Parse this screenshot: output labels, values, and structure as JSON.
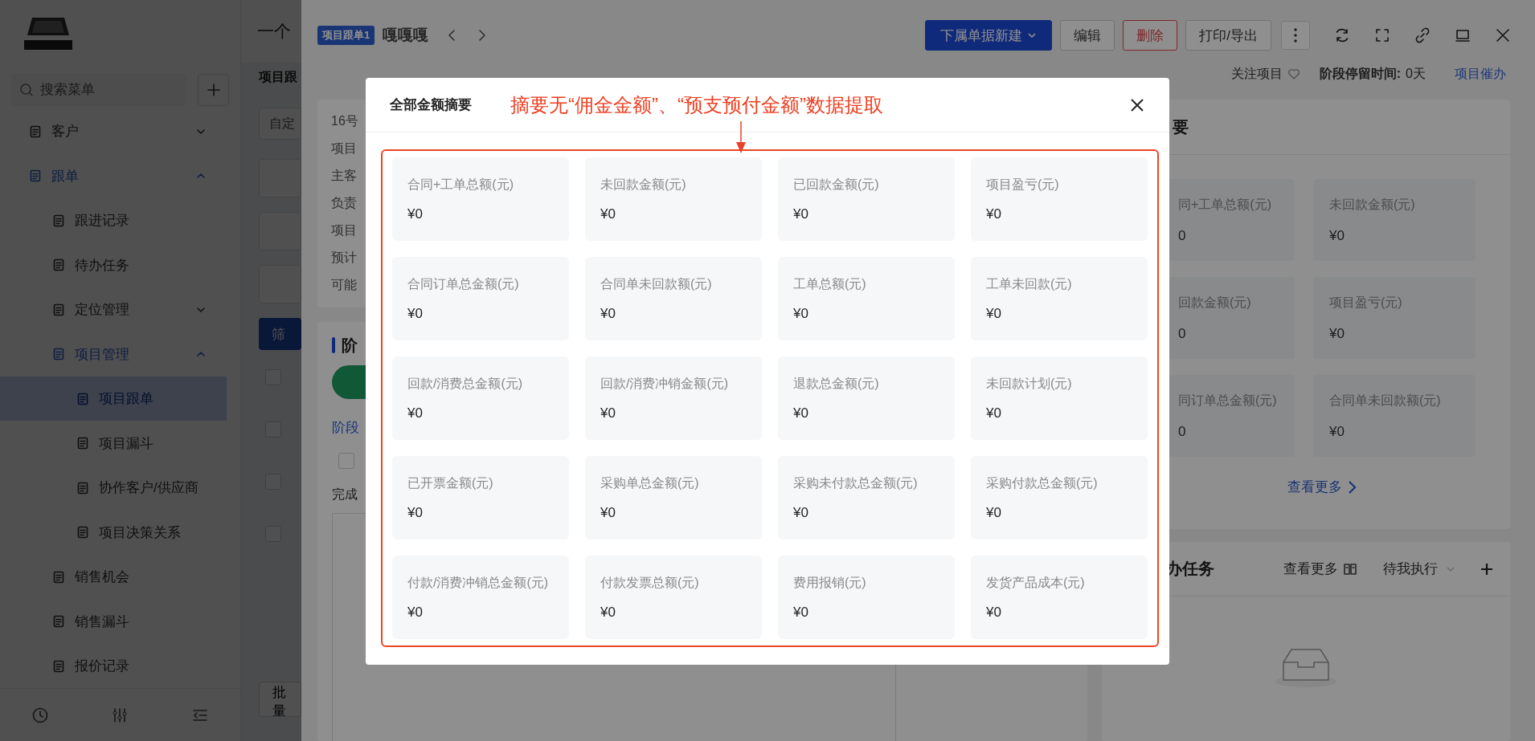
{
  "sidebar": {
    "search": {
      "placeholder": "搜索菜单"
    },
    "items": [
      {
        "label": "客户",
        "selected": false,
        "expanded": false
      },
      {
        "label": "跟单",
        "selected": false,
        "expanded": true,
        "children": [
          {
            "label": "跟进记录",
            "selected": false
          },
          {
            "label": "待办任务",
            "selected": false
          },
          {
            "label": "定位管理",
            "selected": false,
            "expanded": false
          },
          {
            "label": "项目管理",
            "selected": false,
            "expanded": true,
            "children": [
              {
                "label": "项目跟单",
                "selected": true
              },
              {
                "label": "项目漏斗",
                "selected": false
              },
              {
                "label": "协作客户/供应商",
                "selected": false
              },
              {
                "label": "项目决策关系",
                "selected": false
              }
            ]
          },
          {
            "label": "销售机会",
            "selected": false
          },
          {
            "label": "销售漏斗",
            "selected": false
          },
          {
            "label": "报价记录",
            "selected": false
          }
        ]
      }
    ]
  },
  "main": {
    "title": "一个",
    "section_title": "项目跟",
    "filter_placeholder": "自定",
    "filter_button": "筛",
    "row_checkboxes": [
      {
        "checked": false
      },
      {
        "checked": false
      },
      {
        "checked": false
      },
      {
        "checked": false
      }
    ],
    "batch_button": "批量"
  },
  "drawer": {
    "tag": "项目跟单1",
    "name": "嘎嘎嘎",
    "actions": [
      {
        "label": "下属单据新建",
        "kind": "primary"
      },
      {
        "label": "编辑",
        "kind": "default"
      },
      {
        "label": "删除",
        "kind": "danger"
      },
      {
        "label": "打印/导出",
        "kind": "default"
      }
    ],
    "follow_label": "关注项目",
    "stay_label": "阶段停留时间:",
    "stay_value": "0天",
    "urge_link": "项目催办",
    "info_lines": [
      "16号",
      "项目",
      "主客",
      "负责",
      "项目",
      "预计",
      "可能"
    ],
    "stage": {
      "title": "阶",
      "link": "阶段",
      "checkbox": {
        "checked": false
      },
      "done_label": "完成"
    },
    "summary": {
      "title": "要",
      "items": [
        {
          "label": "同+工单总额(元)",
          "value": "0"
        },
        {
          "label": "未回款金额(元)",
          "value": "¥0"
        },
        {
          "label": "回款金额(元)",
          "value": "0"
        },
        {
          "label": "项目盈亏(元)",
          "value": "¥0"
        },
        {
          "label": "同订单总金额(元)",
          "value": "0"
        },
        {
          "label": "合同单未回款额(元)",
          "value": "¥0"
        }
      ],
      "more_link": "查看更多"
    },
    "tasks": {
      "title": "办任务",
      "more_link": "查看更多",
      "filter": "待我执行"
    }
  },
  "modal": {
    "title": "全部金额摘要",
    "annotation": "摘要无“佣金金额”、“预支预付金额”数据提取",
    "items": [
      {
        "label": "合同+工单总额(元)",
        "value": "¥0"
      },
      {
        "label": "未回款金额(元)",
        "value": "¥0"
      },
      {
        "label": "已回款金额(元)",
        "value": "¥0"
      },
      {
        "label": "项目盈亏(元)",
        "value": "¥0"
      },
      {
        "label": "合同订单总金额(元)",
        "value": "¥0"
      },
      {
        "label": "合同单未回款额(元)",
        "value": "¥0"
      },
      {
        "label": "工单总额(元)",
        "value": "¥0"
      },
      {
        "label": "工单未回款(元)",
        "value": "¥0"
      },
      {
        "label": "回款/消费总金额(元)",
        "value": "¥0"
      },
      {
        "label": "回款/消费冲销金额(元)",
        "value": "¥0"
      },
      {
        "label": "退款总金额(元)",
        "value": "¥0"
      },
      {
        "label": "未回款计划(元)",
        "value": "¥0"
      },
      {
        "label": "已开票金额(元)",
        "value": "¥0"
      },
      {
        "label": "采购单总金额(元)",
        "value": "¥0"
      },
      {
        "label": "采购未付款总金额(元)",
        "value": "¥0"
      },
      {
        "label": "采购付款总金额(元)",
        "value": "¥0"
      },
      {
        "label": "付款/消费冲销总金额(元)",
        "value": "¥0"
      },
      {
        "label": "付款发票总额(元)",
        "value": "¥0"
      },
      {
        "label": "费用报销(元)",
        "value": "¥0"
      },
      {
        "label": "发货产品成本(元)",
        "value": "¥0"
      }
    ]
  }
}
